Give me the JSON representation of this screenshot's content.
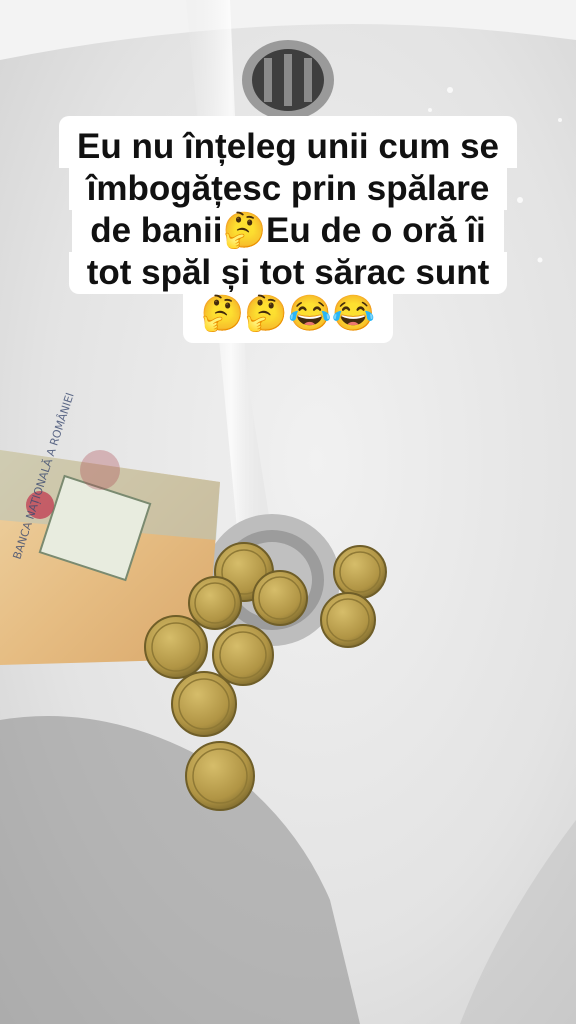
{
  "caption": {
    "lines": [
      "Eu nu înțeleg unii cum se",
      "îmbogățesc prin spălare",
      "de banii🤔Eu de o oră îi",
      "tot spăl și tot sărac sunt",
      "🤔🤔😂😂"
    ]
  },
  "banknote": {
    "printed_text": "BANCA NAȚIONALĂ A ROMÂNIEI"
  },
  "colors": {
    "sink": "#e6e6e6",
    "coin": "#b89a4a",
    "banknote": "#e7c089",
    "caption_bg": "#ffffff"
  }
}
